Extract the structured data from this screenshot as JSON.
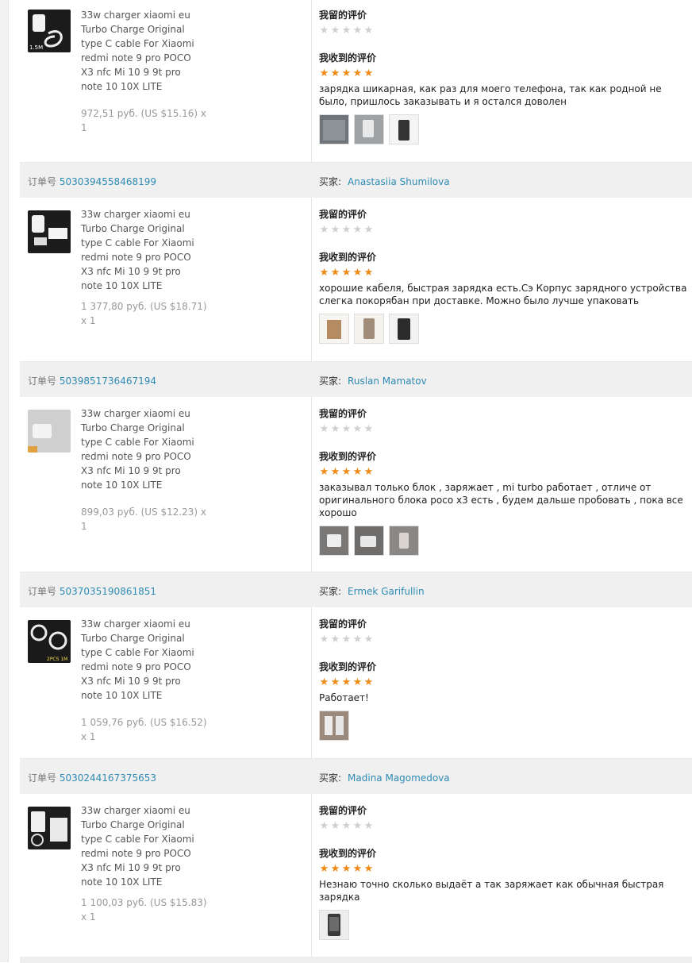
{
  "labels": {
    "order_no": "订单号",
    "buyer": "买家:",
    "my_review": "我留的评价",
    "received_review": "我收到的评价"
  },
  "orders": [
    {
      "order_number": "",
      "buyer_name": "",
      "product_title": "33w charger xiaomi eu Turbo Charge Original type C cable For Xiaomi redmi note 9 pro POCO X3 nfc Mi 10 9 9t pro note 10 10X LITE",
      "price": "972,51 руб. (US $15.16) x 1",
      "my_rating": 0,
      "received_rating": 5,
      "review_text": "зарядка шикарная, как раз для моего телефона, так как родной не было, пришлось заказывать и я остался доволен",
      "thumb_badge": "1.5M",
      "photos": [
        "photo-gray-cloth",
        "photo-white-charger",
        "photo-phone-dark"
      ]
    },
    {
      "order_number": "5030394558468199",
      "buyer_name": "Anastasiia Shumilova",
      "product_title": "33w charger xiaomi eu Turbo Charge Original type C cable For Xiaomi redmi note 9 pro POCO X3 nfc Mi 10 9 9t pro note 10 10X LITE",
      "price": "1 377,80 руб. (US $18.71) x 1",
      "my_rating": 0,
      "received_rating": 5,
      "review_text": "хорошие кабеля, быстрая зарядка есть.Сэ Корпус зарядного устройства слегка покорябан при доставке. Можно было лучше упаковать",
      "thumb_badge": "",
      "photos": [
        "photo-charger-box",
        "photo-charger-white",
        "photo-phone-dark"
      ]
    },
    {
      "order_number": "5039851736467194",
      "buyer_name": "Ruslan Mamatov",
      "product_title": "33w charger xiaomi eu Turbo Charge Original type C cable For Xiaomi redmi note 9 pro POCO X3 nfc Mi 10 9 9t pro note 10 10X LITE",
      "price": "899,03 руб. (US $12.23) x 1",
      "my_rating": 0,
      "received_rating": 5,
      "review_text": "заказывал только блок , заряжает , mi turbo работает , отличе от оригинального блока poco x3 есть , будем дальше пробовать , пока все хорошо",
      "thumb_badge": "",
      "photos": [
        "photo-charger-gray",
        "photo-charger-gray",
        "photo-charger-table"
      ]
    },
    {
      "order_number": "5037035190861851",
      "buyer_name": "Ermek Garifullin",
      "product_title": "33w charger xiaomi eu Turbo Charge Original type C cable For Xiaomi redmi note 9 pro POCO X3 nfc Mi 10 9 9t pro note 10 10X LITE",
      "price": "1 059,76 руб. (US $16.52) x 1",
      "my_rating": 0,
      "received_rating": 5,
      "review_text": "Работает!",
      "thumb_badge": "2PCS 1M",
      "photos": [
        "photo-cables"
      ]
    },
    {
      "order_number": "5030244167375653",
      "buyer_name": "Madina Magomedova",
      "product_title": "33w charger xiaomi eu Turbo Charge Original type C cable For Xiaomi redmi note 9 pro POCO X3 nfc Mi 10 9 9t pro note 10 10X LITE",
      "price": "1 100,03 руб. (US $15.83) x 1",
      "my_rating": 0,
      "received_rating": 5,
      "review_text": "Незнаю точно сколько выдаёт а так заряжает как обычная быстрая зарядка",
      "thumb_badge": "",
      "photos": [
        "photo-phone-box"
      ]
    }
  ],
  "colors": {
    "link": "#2e8bb3",
    "star_on": "#ef8a16",
    "star_off": "#d0d0d0",
    "header_bg": "#f0f0f0"
  }
}
